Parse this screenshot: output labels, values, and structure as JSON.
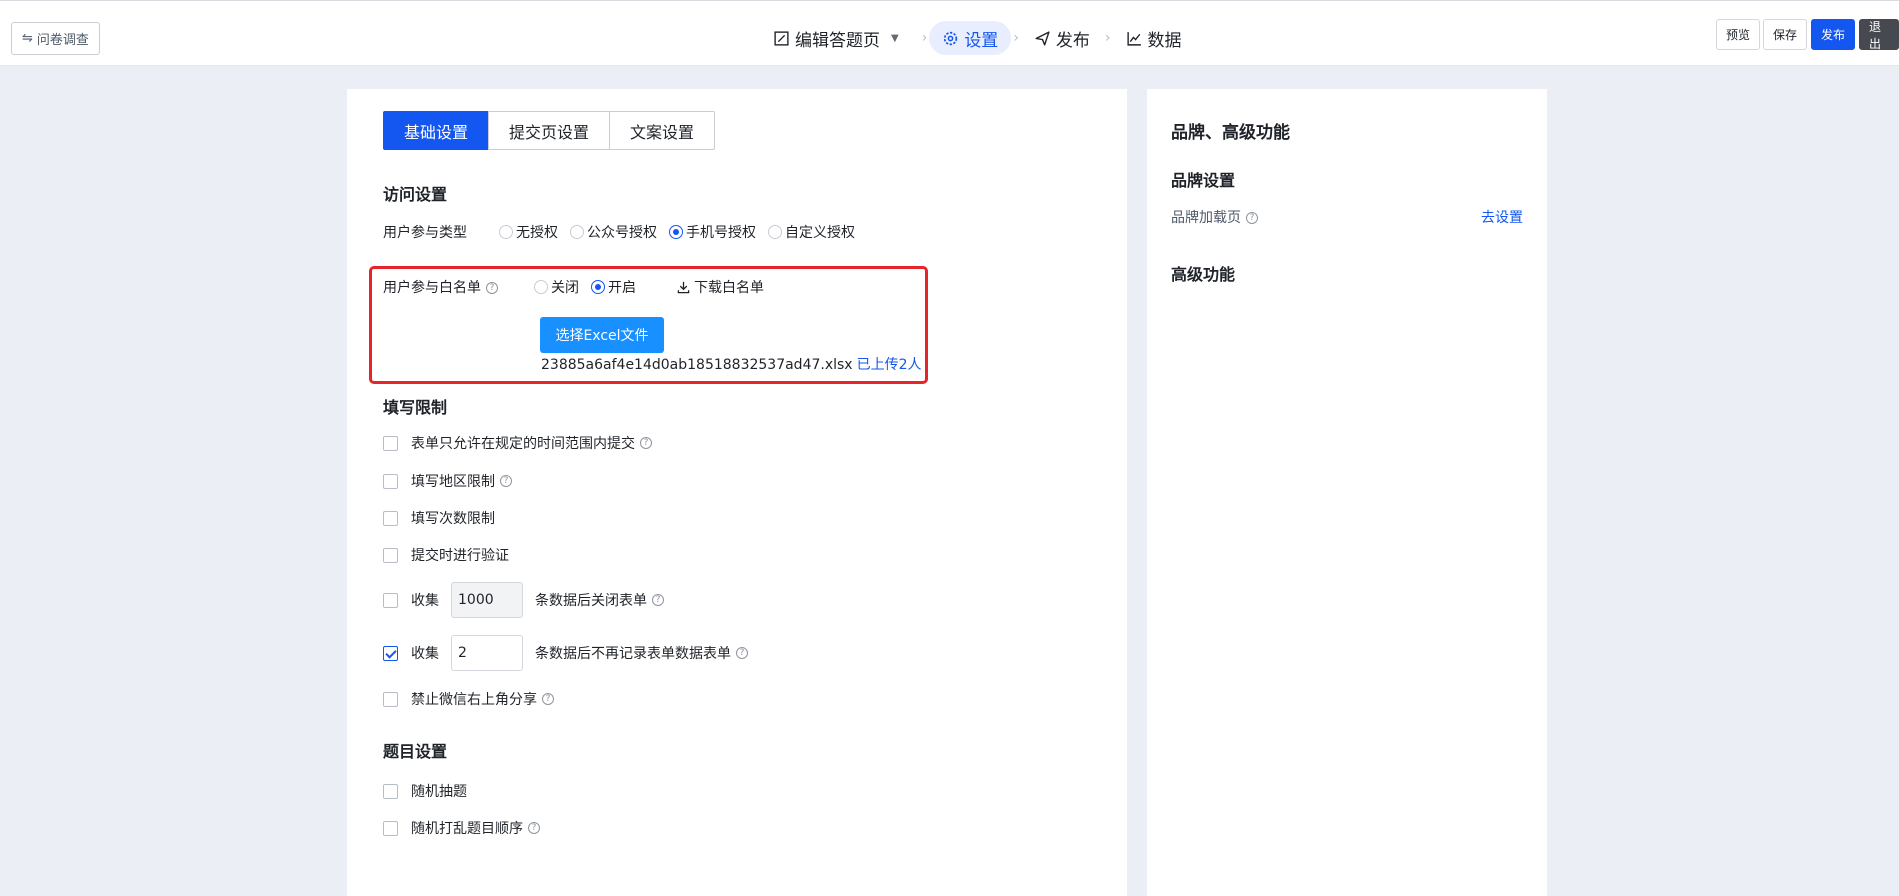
{
  "header": {
    "back_label": "问卷调查",
    "steps": [
      {
        "label": "编辑答题页",
        "icon": "edit-icon"
      },
      {
        "label": "设置",
        "icon": "gear-icon"
      },
      {
        "label": "发布",
        "icon": "send-icon"
      },
      {
        "label": "数据",
        "icon": "chart-icon"
      }
    ],
    "active_step": "设置",
    "buttons": {
      "preview": "预览",
      "save": "保存",
      "publish": "发布",
      "exit": "退出"
    }
  },
  "tabs": [
    {
      "label": "基础设置",
      "active": true
    },
    {
      "label": "提交页设置",
      "active": false
    },
    {
      "label": "文案设置",
      "active": false
    }
  ],
  "access": {
    "title": "访问设置",
    "user_type_label": "用户参与类型",
    "user_type_options": [
      "无授权",
      "公众号授权",
      "手机号授权",
      "自定义授权"
    ],
    "user_type_selected": "手机号授权",
    "whitelist_label": "用户参与白名单",
    "whitelist_options": [
      "关闭",
      "开启"
    ],
    "whitelist_selected": "开启",
    "download_label": "下载白名单",
    "upload_button": "选择Excel文件",
    "file_name": "23885a6af4e14d0ab18518832537ad47.xlsx",
    "uploaded_text": "已上传2人"
  },
  "limits": {
    "title": "填写限制",
    "items": [
      {
        "label": "表单只允许在规定的时间范围内提交",
        "checked": false,
        "help": true
      },
      {
        "label": "填写地区限制",
        "checked": false,
        "help": true
      },
      {
        "label": "填写次数限制",
        "checked": false,
        "help": false
      },
      {
        "label": "提交时进行验证",
        "checked": false,
        "help": false
      }
    ],
    "collect_close": {
      "prefix": "收集",
      "value": "1000",
      "suffix": "条数据后关闭表单",
      "checked": false
    },
    "collect_stop": {
      "prefix": "收集",
      "value": "2",
      "suffix": "条数据后不再记录表单数据表单",
      "checked": true
    },
    "share": {
      "label": "禁止微信右上角分享",
      "checked": false
    }
  },
  "questions": {
    "title": "题目设置",
    "items": [
      {
        "label": "随机抽题",
        "checked": false,
        "help": false
      },
      {
        "label": "随机打乱题目顺序",
        "checked": false,
        "help": true
      }
    ]
  },
  "right_panel": {
    "title": "品牌、高级功能",
    "brand_title": "品牌设置",
    "brand_row_label": "品牌加载页",
    "brand_row_link": "去设置",
    "advanced_title": "高级功能"
  },
  "colors": {
    "accent": "#1456f0",
    "upload": "#1890ff",
    "highlight": "#e5252a",
    "background": "#ebeef5"
  }
}
